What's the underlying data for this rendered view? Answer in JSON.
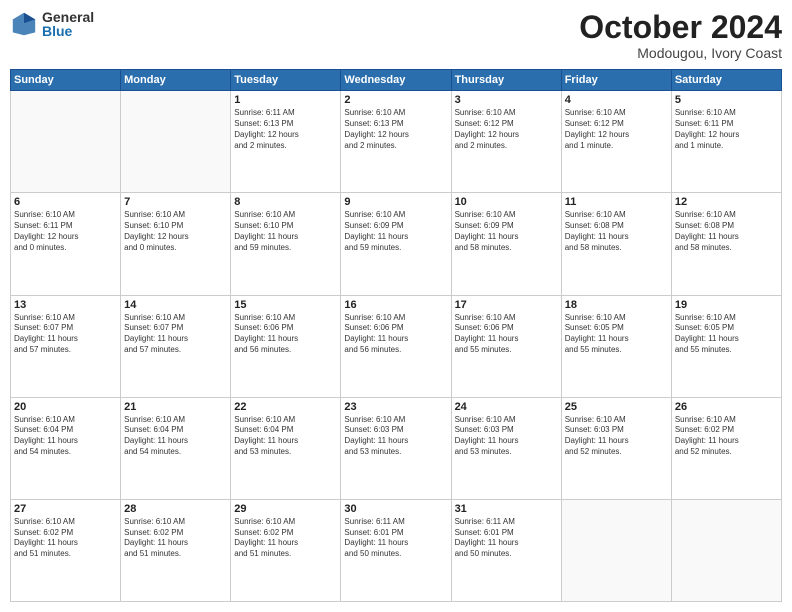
{
  "logo": {
    "general": "General",
    "blue": "Blue"
  },
  "title": "October 2024",
  "location": "Modougou, Ivory Coast",
  "days_header": [
    "Sunday",
    "Monday",
    "Tuesday",
    "Wednesday",
    "Thursday",
    "Friday",
    "Saturday"
  ],
  "weeks": [
    [
      {
        "day": "",
        "lines": []
      },
      {
        "day": "",
        "lines": []
      },
      {
        "day": "1",
        "lines": [
          "Sunrise: 6:11 AM",
          "Sunset: 6:13 PM",
          "Daylight: 12 hours",
          "and 2 minutes."
        ]
      },
      {
        "day": "2",
        "lines": [
          "Sunrise: 6:10 AM",
          "Sunset: 6:13 PM",
          "Daylight: 12 hours",
          "and 2 minutes."
        ]
      },
      {
        "day": "3",
        "lines": [
          "Sunrise: 6:10 AM",
          "Sunset: 6:12 PM",
          "Daylight: 12 hours",
          "and 2 minutes."
        ]
      },
      {
        "day": "4",
        "lines": [
          "Sunrise: 6:10 AM",
          "Sunset: 6:12 PM",
          "Daylight: 12 hours",
          "and 1 minute."
        ]
      },
      {
        "day": "5",
        "lines": [
          "Sunrise: 6:10 AM",
          "Sunset: 6:11 PM",
          "Daylight: 12 hours",
          "and 1 minute."
        ]
      }
    ],
    [
      {
        "day": "6",
        "lines": [
          "Sunrise: 6:10 AM",
          "Sunset: 6:11 PM",
          "Daylight: 12 hours",
          "and 0 minutes."
        ]
      },
      {
        "day": "7",
        "lines": [
          "Sunrise: 6:10 AM",
          "Sunset: 6:10 PM",
          "Daylight: 12 hours",
          "and 0 minutes."
        ]
      },
      {
        "day": "8",
        "lines": [
          "Sunrise: 6:10 AM",
          "Sunset: 6:10 PM",
          "Daylight: 11 hours",
          "and 59 minutes."
        ]
      },
      {
        "day": "9",
        "lines": [
          "Sunrise: 6:10 AM",
          "Sunset: 6:09 PM",
          "Daylight: 11 hours",
          "and 59 minutes."
        ]
      },
      {
        "day": "10",
        "lines": [
          "Sunrise: 6:10 AM",
          "Sunset: 6:09 PM",
          "Daylight: 11 hours",
          "and 58 minutes."
        ]
      },
      {
        "day": "11",
        "lines": [
          "Sunrise: 6:10 AM",
          "Sunset: 6:08 PM",
          "Daylight: 11 hours",
          "and 58 minutes."
        ]
      },
      {
        "day": "12",
        "lines": [
          "Sunrise: 6:10 AM",
          "Sunset: 6:08 PM",
          "Daylight: 11 hours",
          "and 58 minutes."
        ]
      }
    ],
    [
      {
        "day": "13",
        "lines": [
          "Sunrise: 6:10 AM",
          "Sunset: 6:07 PM",
          "Daylight: 11 hours",
          "and 57 minutes."
        ]
      },
      {
        "day": "14",
        "lines": [
          "Sunrise: 6:10 AM",
          "Sunset: 6:07 PM",
          "Daylight: 11 hours",
          "and 57 minutes."
        ]
      },
      {
        "day": "15",
        "lines": [
          "Sunrise: 6:10 AM",
          "Sunset: 6:06 PM",
          "Daylight: 11 hours",
          "and 56 minutes."
        ]
      },
      {
        "day": "16",
        "lines": [
          "Sunrise: 6:10 AM",
          "Sunset: 6:06 PM",
          "Daylight: 11 hours",
          "and 56 minutes."
        ]
      },
      {
        "day": "17",
        "lines": [
          "Sunrise: 6:10 AM",
          "Sunset: 6:06 PM",
          "Daylight: 11 hours",
          "and 55 minutes."
        ]
      },
      {
        "day": "18",
        "lines": [
          "Sunrise: 6:10 AM",
          "Sunset: 6:05 PM",
          "Daylight: 11 hours",
          "and 55 minutes."
        ]
      },
      {
        "day": "19",
        "lines": [
          "Sunrise: 6:10 AM",
          "Sunset: 6:05 PM",
          "Daylight: 11 hours",
          "and 55 minutes."
        ]
      }
    ],
    [
      {
        "day": "20",
        "lines": [
          "Sunrise: 6:10 AM",
          "Sunset: 6:04 PM",
          "Daylight: 11 hours",
          "and 54 minutes."
        ]
      },
      {
        "day": "21",
        "lines": [
          "Sunrise: 6:10 AM",
          "Sunset: 6:04 PM",
          "Daylight: 11 hours",
          "and 54 minutes."
        ]
      },
      {
        "day": "22",
        "lines": [
          "Sunrise: 6:10 AM",
          "Sunset: 6:04 PM",
          "Daylight: 11 hours",
          "and 53 minutes."
        ]
      },
      {
        "day": "23",
        "lines": [
          "Sunrise: 6:10 AM",
          "Sunset: 6:03 PM",
          "Daylight: 11 hours",
          "and 53 minutes."
        ]
      },
      {
        "day": "24",
        "lines": [
          "Sunrise: 6:10 AM",
          "Sunset: 6:03 PM",
          "Daylight: 11 hours",
          "and 53 minutes."
        ]
      },
      {
        "day": "25",
        "lines": [
          "Sunrise: 6:10 AM",
          "Sunset: 6:03 PM",
          "Daylight: 11 hours",
          "and 52 minutes."
        ]
      },
      {
        "day": "26",
        "lines": [
          "Sunrise: 6:10 AM",
          "Sunset: 6:02 PM",
          "Daylight: 11 hours",
          "and 52 minutes."
        ]
      }
    ],
    [
      {
        "day": "27",
        "lines": [
          "Sunrise: 6:10 AM",
          "Sunset: 6:02 PM",
          "Daylight: 11 hours",
          "and 51 minutes."
        ]
      },
      {
        "day": "28",
        "lines": [
          "Sunrise: 6:10 AM",
          "Sunset: 6:02 PM",
          "Daylight: 11 hours",
          "and 51 minutes."
        ]
      },
      {
        "day": "29",
        "lines": [
          "Sunrise: 6:10 AM",
          "Sunset: 6:02 PM",
          "Daylight: 11 hours",
          "and 51 minutes."
        ]
      },
      {
        "day": "30",
        "lines": [
          "Sunrise: 6:11 AM",
          "Sunset: 6:01 PM",
          "Daylight: 11 hours",
          "and 50 minutes."
        ]
      },
      {
        "day": "31",
        "lines": [
          "Sunrise: 6:11 AM",
          "Sunset: 6:01 PM",
          "Daylight: 11 hours",
          "and 50 minutes."
        ]
      },
      {
        "day": "",
        "lines": []
      },
      {
        "day": "",
        "lines": []
      }
    ]
  ]
}
